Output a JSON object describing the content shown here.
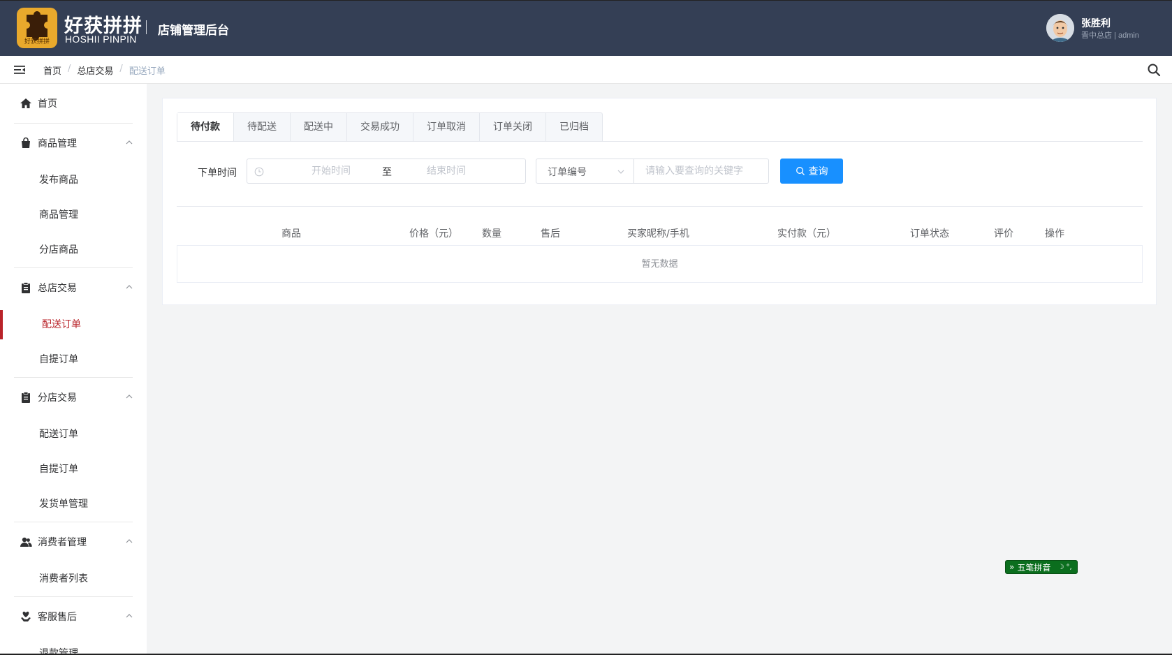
{
  "header": {
    "logo_caption": "好获拼拼",
    "brand_cn": "好获拼拼",
    "brand_en": "HOSHII PINPIN",
    "admin_title": "店铺管理后台",
    "user_name": "张胜利",
    "user_sub": "晋中总店 | admin"
  },
  "breadcrumb": {
    "items": [
      "首页",
      "总店交易",
      "配送订单"
    ],
    "separator": "/"
  },
  "sidebar": {
    "home": "首页",
    "groups": [
      {
        "label": "商品管理",
        "icon": "bag-icon",
        "items": [
          "发布商品",
          "商品管理",
          "分店商品"
        ]
      },
      {
        "label": "总店交易",
        "icon": "clipboard-icon",
        "items": [
          "配送订单",
          "自提订单"
        ],
        "active_item": "配送订单"
      },
      {
        "label": "分店交易",
        "icon": "clipboard-icon",
        "items": [
          "配送订单",
          "自提订单",
          "发货单管理"
        ]
      },
      {
        "label": "消费者管理",
        "icon": "users-icon",
        "items": [
          "消费者列表"
        ]
      },
      {
        "label": "客服售后",
        "icon": "heart-hand-icon",
        "items": [
          "退款管理"
        ]
      }
    ]
  },
  "tabs": [
    "待付款",
    "待配送",
    "配送中",
    "交易成功",
    "订单取消",
    "订单关闭",
    "已归档"
  ],
  "active_tab": "待付款",
  "filter": {
    "label": "下单时间",
    "start_placeholder": "开始时间",
    "range_separator": "至",
    "end_placeholder": "结束时间",
    "select_value": "订单编号",
    "keyword_placeholder": "请输入要查询的关键字",
    "query_label": "查询"
  },
  "table": {
    "columns": [
      "商品",
      "价格（元）",
      "数量",
      "售后",
      "买家昵称/手机",
      "实付款（元）",
      "订单状态",
      "评价",
      "操作"
    ],
    "empty_text": "暂无数据"
  },
  "ime": {
    "label": "五笔拼音"
  },
  "colors": {
    "header_bg": "#343f55",
    "accent": "#b92329",
    "primary": "#1890ff",
    "logo": "#e9a92c"
  }
}
